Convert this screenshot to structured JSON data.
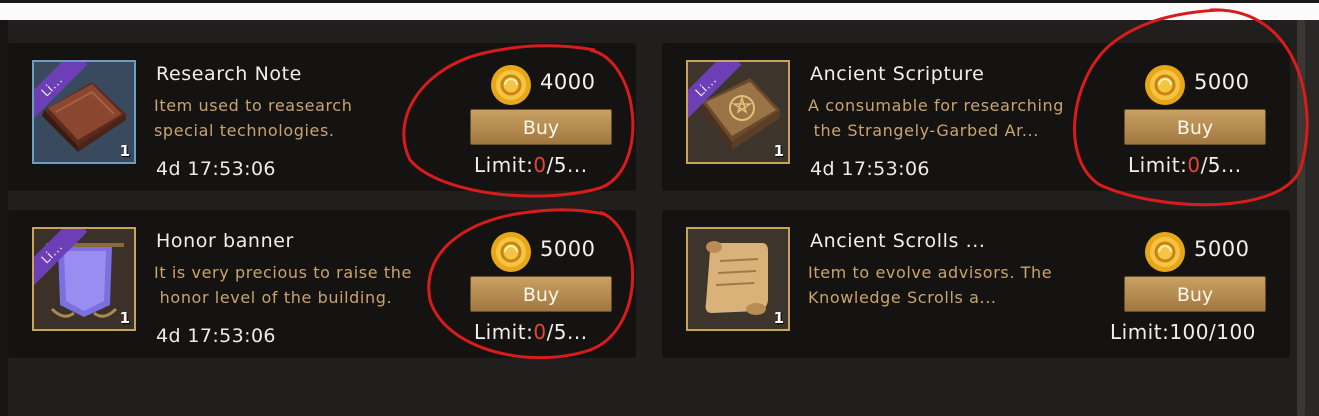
{
  "items": [
    {
      "title": "Research Note",
      "ribbon": "Li...",
      "quantity": "1",
      "description_line1": "Item used to reasearch",
      "description_line2": "special technologies.",
      "timer": "4d 17:53:06",
      "price": "4000",
      "buy_label": "Buy",
      "limit_prefix": "Limit:",
      "limit_used": "0",
      "limit_rest": "/5...",
      "icon": "research-note-book-icon",
      "frame_color": "#6f9cc2"
    },
    {
      "title": "Ancient Scripture",
      "ribbon": "Li...",
      "quantity": "1",
      "description_line1": "A consumable for researching",
      "description_line2": " the Strangely-Garbed Ar...",
      "timer": "4d 17:53:06",
      "price": "5000",
      "buy_label": "Buy",
      "limit_prefix": "Limit:",
      "limit_used": "0",
      "limit_rest": "/5...",
      "icon": "ancient-scripture-book-icon",
      "frame_color": "#c9a35a"
    },
    {
      "title": "Honor banner",
      "ribbon": "Li...",
      "quantity": "1",
      "description_line1": "It is very precious to raise the",
      "description_line2": " honor level of the building.",
      "timer": "4d 17:53:06",
      "price": "5000",
      "buy_label": "Buy",
      "limit_prefix": "Limit:",
      "limit_used": "0",
      "limit_rest": "/5...",
      "icon": "honor-banner-icon",
      "frame_color": "#c9a35a"
    },
    {
      "title": "Ancient Scrolls ...",
      "quantity": "1",
      "description_line1": "Item to evolve advisors. The",
      "description_line2": "Knowledge Scrolls a...",
      "price": "5000",
      "buy_label": "Buy",
      "limit_full": "Limit:100/100",
      "icon": "ancient-scroll-icon",
      "frame_color": "#c9a35a"
    }
  ],
  "currency_icon": "gold-coin-icon",
  "annotation_color": "#d81c1c",
  "colors": {
    "description": "#c9a46c",
    "limit_highlight": "#e54631",
    "button": "#b88e55",
    "ribbon": "#6d3fb6"
  }
}
